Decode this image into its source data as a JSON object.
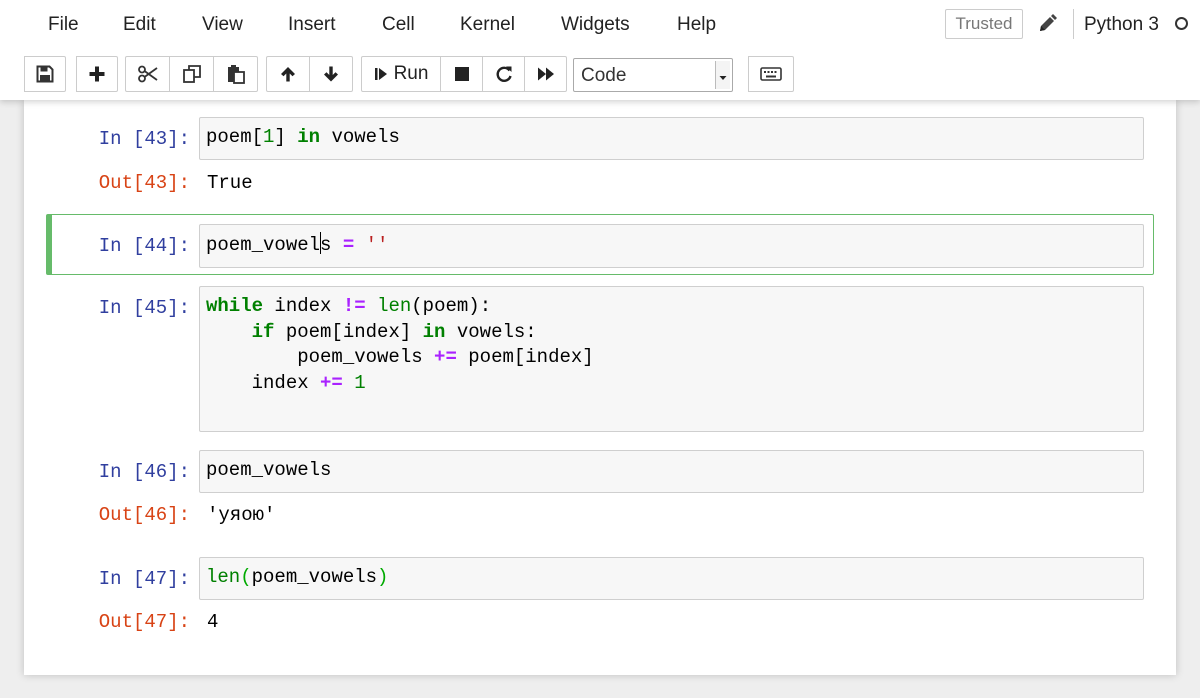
{
  "menu": {
    "items": [
      "File",
      "Edit",
      "View",
      "Insert",
      "Cell",
      "Kernel",
      "Widgets",
      "Help"
    ],
    "trusted_label": "Trusted",
    "kernel_name": "Python 3"
  },
  "toolbar": {
    "buttons": [
      {
        "name": "save",
        "icon": "floppy-disk-icon"
      },
      {
        "name": "insert-cell-below",
        "icon": "plus-icon"
      },
      {
        "name": "cut-cells",
        "icon": "scissors-icon"
      },
      {
        "name": "copy-cells",
        "icon": "copy-icon"
      },
      {
        "name": "paste-cells",
        "icon": "clipboard-icon"
      },
      {
        "name": "move-up",
        "icon": "arrow-up-icon"
      },
      {
        "name": "move-down",
        "icon": "arrow-down-icon"
      },
      {
        "name": "run",
        "icon": "step-forward-icon"
      },
      {
        "name": "interrupt",
        "icon": "stop-icon"
      },
      {
        "name": "restart",
        "icon": "redo-icon"
      },
      {
        "name": "restart-run-all",
        "icon": "fast-forward-icon"
      },
      {
        "name": "command-palette",
        "icon": "keyboard-icon"
      }
    ],
    "run_label": "Run",
    "cell_type": "Code"
  },
  "cells": [
    {
      "in_prompt": "In [43]:",
      "source": "poem[1] in vowels",
      "out_prompt": "Out[43]:",
      "output": "True"
    },
    {
      "in_prompt": "In [44]:",
      "source": "poem_vowels = ''",
      "selected": true
    },
    {
      "in_prompt": "In [45]:",
      "source_lines": [
        "while index != len(poem):",
        "    if poem[index] in vowels:",
        "        poem_vowels += poem[index]",
        "    index += 1"
      ]
    },
    {
      "in_prompt": "In [46]:",
      "source": "poem_vowels",
      "out_prompt": "Out[46]:",
      "output": "'уяою'"
    },
    {
      "in_prompt": "In [47]:",
      "source": "len(poem_vowels)",
      "out_prompt": "Out[47]:",
      "output": "4"
    }
  ],
  "colors": {
    "in_prompt": "#303f9f",
    "out_prompt": "#d84315",
    "keyword": "#008000",
    "operator": "#aa22ff",
    "string": "#ba2121",
    "selected_cell_border": "#66bb6a"
  }
}
